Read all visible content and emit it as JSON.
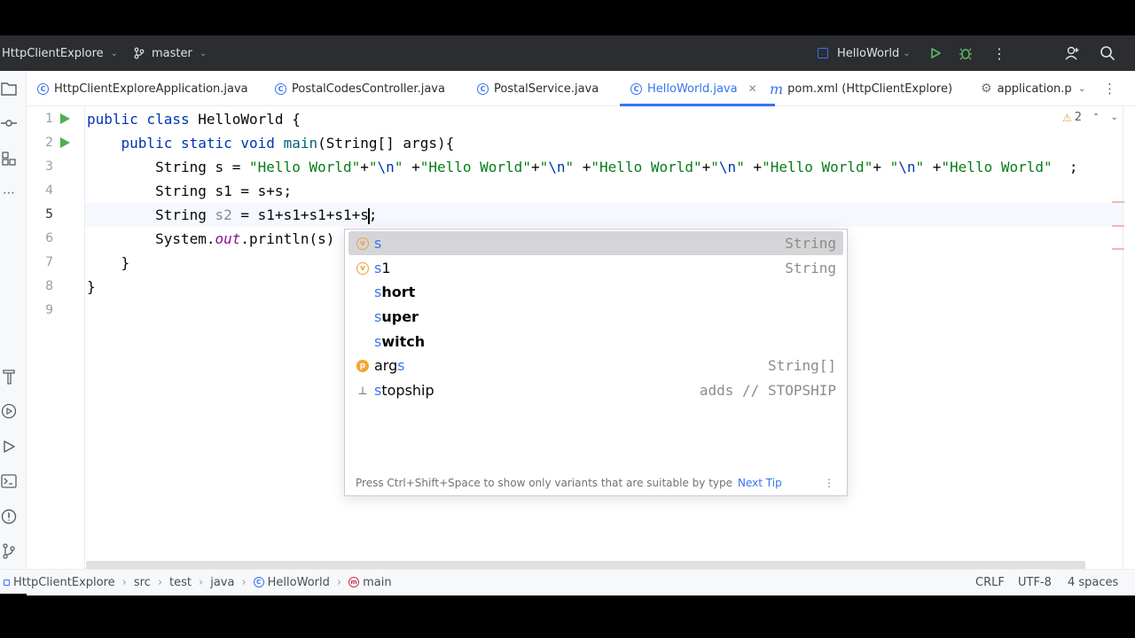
{
  "topbar": {
    "project": "HttpClientExplore",
    "branch": "master",
    "run_config": "HelloWorld"
  },
  "tabs": [
    {
      "label": "HttpClientExploreApplication.java"
    },
    {
      "label": "PostalCodesController.java"
    },
    {
      "label": "PostalService.java"
    },
    {
      "label": "HelloWorld.java",
      "active": true
    },
    {
      "label": "pom.xml (HttpClientExplore)"
    },
    {
      "label": "application.p"
    }
  ],
  "editor": {
    "line_numbers": [
      "1",
      "2",
      "3",
      "4",
      "5",
      "6",
      "7",
      "8",
      "9"
    ],
    "warnings_count": "2",
    "lines": [
      "public class HelloWorld {",
      "    public static void main(String[] args){",
      "        String s = \"Hello World\"+\"\\n\" +\"Hello World\"+\"\\n\" +\"Hello World\"+\"\\n\" +\"Hello World\"+ \"\\n\" +\"Hello World\"  ;",
      "        String s1 = s+s;",
      "        String s2 = s1+s1+s1+s1+s;",
      "        System.out.println(s)",
      "    }",
      "}",
      ""
    ]
  },
  "completion": {
    "items": [
      {
        "name": "s",
        "match": "s",
        "rest": "",
        "type": "String",
        "icon": "variable-icon"
      },
      {
        "name": "s1",
        "match": "s",
        "rest": "1",
        "type": "String",
        "icon": "variable-icon"
      },
      {
        "name": "short",
        "match": "s",
        "rest": "hort",
        "type": "",
        "icon": "keyword"
      },
      {
        "name": "super",
        "match": "s",
        "rest": "uper",
        "type": "",
        "icon": "keyword"
      },
      {
        "name": "switch",
        "match": "s",
        "rest": "witch",
        "type": "",
        "icon": "keyword"
      },
      {
        "name": "args",
        "match": "s",
        "rest": "",
        "type": "String[]",
        "icon": "parameter-icon"
      },
      {
        "name": "stopship",
        "match": "s",
        "rest": "topship",
        "type": "adds // STOPSHIP",
        "icon": "template-icon"
      }
    ],
    "tip": "Press Ctrl+Shift+Space to show only variants that are suitable by type",
    "tip_link": "Next Tip"
  },
  "breadcrumb": [
    "HttpClientExplore",
    "src",
    "test",
    "java",
    "HelloWorld",
    "main"
  ],
  "status": {
    "line_ending": "CRLF",
    "encoding": "UTF-8",
    "indent": "4 spaces"
  }
}
